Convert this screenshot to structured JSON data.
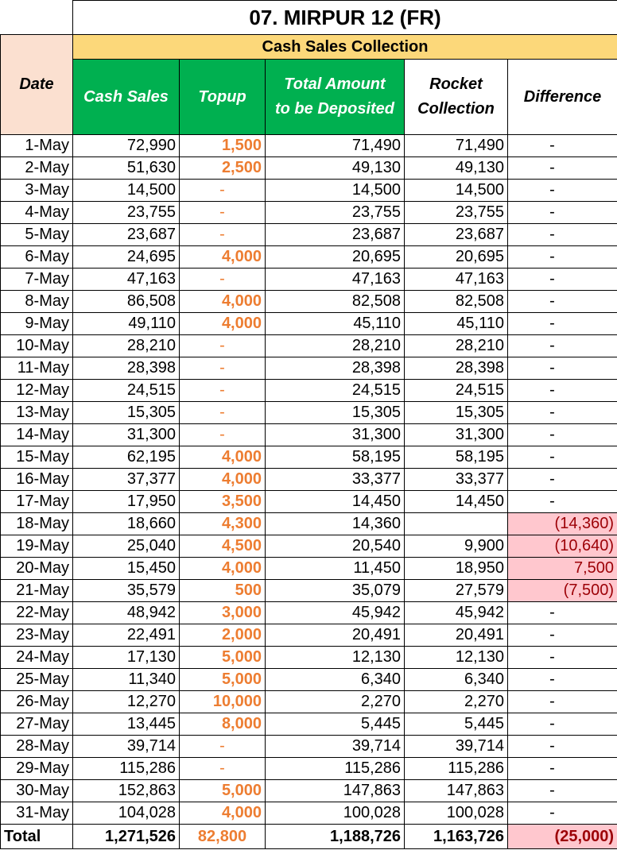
{
  "title": "07. MIRPUR 12 (FR)",
  "section_title": "Cash Sales Collection",
  "headers": {
    "date": "Date",
    "cash_sales": "Cash Sales",
    "topup": "Topup",
    "total_amount_line1": "Total Amount",
    "total_amount_line2": "to be Deposited",
    "rocket_line1": "Rocket",
    "rocket_line2": "Collection",
    "difference": "Difference"
  },
  "rows": [
    {
      "date": "1-May",
      "cash": "72,990",
      "topup": "1,500",
      "total": "71,490",
      "rocket": "71,490",
      "diff": "-",
      "flag": false
    },
    {
      "date": "2-May",
      "cash": "51,630",
      "topup": "2,500",
      "total": "49,130",
      "rocket": "49,130",
      "diff": "-",
      "flag": false
    },
    {
      "date": "3-May",
      "cash": "14,500",
      "topup": "-",
      "total": "14,500",
      "rocket": "14,500",
      "diff": "-",
      "flag": false
    },
    {
      "date": "4-May",
      "cash": "23,755",
      "topup": "-",
      "total": "23,755",
      "rocket": "23,755",
      "diff": "-",
      "flag": false
    },
    {
      "date": "5-May",
      "cash": "23,687",
      "topup": "-",
      "total": "23,687",
      "rocket": "23,687",
      "diff": "-",
      "flag": false
    },
    {
      "date": "6-May",
      "cash": "24,695",
      "topup": "4,000",
      "total": "20,695",
      "rocket": "20,695",
      "diff": "-",
      "flag": false
    },
    {
      "date": "7-May",
      "cash": "47,163",
      "topup": "-",
      "total": "47,163",
      "rocket": "47,163",
      "diff": "-",
      "flag": false
    },
    {
      "date": "8-May",
      "cash": "86,508",
      "topup": "4,000",
      "total": "82,508",
      "rocket": "82,508",
      "diff": "-",
      "flag": false
    },
    {
      "date": "9-May",
      "cash": "49,110",
      "topup": "4,000",
      "total": "45,110",
      "rocket": "45,110",
      "diff": "-",
      "flag": false
    },
    {
      "date": "10-May",
      "cash": "28,210",
      "topup": "-",
      "total": "28,210",
      "rocket": "28,210",
      "diff": "-",
      "flag": false
    },
    {
      "date": "11-May",
      "cash": "28,398",
      "topup": "-",
      "total": "28,398",
      "rocket": "28,398",
      "diff": "-",
      "flag": false
    },
    {
      "date": "12-May",
      "cash": "24,515",
      "topup": "-",
      "total": "24,515",
      "rocket": "24,515",
      "diff": "-",
      "flag": false
    },
    {
      "date": "13-May",
      "cash": "15,305",
      "topup": "-",
      "total": "15,305",
      "rocket": "15,305",
      "diff": "-",
      "flag": false
    },
    {
      "date": "14-May",
      "cash": "31,300",
      "topup": "-",
      "total": "31,300",
      "rocket": "31,300",
      "diff": "-",
      "flag": false
    },
    {
      "date": "15-May",
      "cash": "62,195",
      "topup": "4,000",
      "total": "58,195",
      "rocket": "58,195",
      "diff": "-",
      "flag": false
    },
    {
      "date": "16-May",
      "cash": "37,377",
      "topup": "4,000",
      "total": "33,377",
      "rocket": "33,377",
      "diff": "-",
      "flag": false
    },
    {
      "date": "17-May",
      "cash": "17,950",
      "topup": "3,500",
      "total": "14,450",
      "rocket": "14,450",
      "diff": "-",
      "flag": false
    },
    {
      "date": "18-May",
      "cash": "18,660",
      "topup": "4,300",
      "total": "14,360",
      "rocket": "",
      "diff": "(14,360)",
      "flag": true
    },
    {
      "date": "19-May",
      "cash": "25,040",
      "topup": "4,500",
      "total": "20,540",
      "rocket": "9,900",
      "diff": "(10,640)",
      "flag": true
    },
    {
      "date": "20-May",
      "cash": "15,450",
      "topup": "4,000",
      "total": "11,450",
      "rocket": "18,950",
      "diff": "7,500",
      "flag": true
    },
    {
      "date": "21-May",
      "cash": "35,579",
      "topup": "500",
      "total": "35,079",
      "rocket": "27,579",
      "diff": "(7,500)",
      "flag": true
    },
    {
      "date": "22-May",
      "cash": "48,942",
      "topup": "3,000",
      "total": "45,942",
      "rocket": "45,942",
      "diff": "-",
      "flag": false
    },
    {
      "date": "23-May",
      "cash": "22,491",
      "topup": "2,000",
      "total": "20,491",
      "rocket": "20,491",
      "diff": "-",
      "flag": false
    },
    {
      "date": "24-May",
      "cash": "17,130",
      "topup": "5,000",
      "total": "12,130",
      "rocket": "12,130",
      "diff": "-",
      "flag": false
    },
    {
      "date": "25-May",
      "cash": "11,340",
      "topup": "5,000",
      "total": "6,340",
      "rocket": "6,340",
      "diff": "-",
      "flag": false
    },
    {
      "date": "26-May",
      "cash": "12,270",
      "topup": "10,000",
      "total": "2,270",
      "rocket": "2,270",
      "diff": "-",
      "flag": false
    },
    {
      "date": "27-May",
      "cash": "13,445",
      "topup": "8,000",
      "total": "5,445",
      "rocket": "5,445",
      "diff": "-",
      "flag": false
    },
    {
      "date": "28-May",
      "cash": "39,714",
      "topup": "-",
      "total": "39,714",
      "rocket": "39,714",
      "diff": "-",
      "flag": false
    },
    {
      "date": "29-May",
      "cash": "115,286",
      "topup": "-",
      "total": "115,286",
      "rocket": "115,286",
      "diff": "-",
      "flag": false
    },
    {
      "date": "30-May",
      "cash": "152,863",
      "topup": "5,000",
      "total": "147,863",
      "rocket": "147,863",
      "diff": "-",
      "flag": false
    },
    {
      "date": "31-May",
      "cash": "104,028",
      "topup": "4,000",
      "total": "100,028",
      "rocket": "100,028",
      "diff": "-",
      "flag": false
    }
  ],
  "totals": {
    "label": "Total",
    "cash": "1,271,526",
    "topup": "82,800",
    "total": "1,188,726",
    "rocket": "1,163,726",
    "diff": "(25,000)"
  },
  "colors": {
    "header_green": "#00b050",
    "section_yellow": "#fcd87a",
    "date_header_peach": "#fbe0d0",
    "topup_orange": "#ed7d31",
    "flag_fill": "#ffc7ce",
    "flag_text": "#9c0006"
  }
}
